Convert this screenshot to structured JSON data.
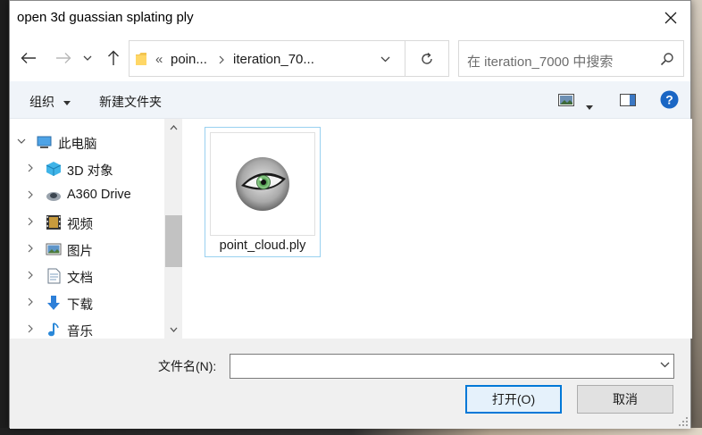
{
  "dialog": {
    "title": "open 3d guassian splating ply"
  },
  "address": {
    "overflow_marker": "«",
    "crumbs": [
      "poin...",
      "iteration_70..."
    ]
  },
  "search": {
    "placeholder": "在 iteration_7000 中搜索"
  },
  "toolbar": {
    "organize_label": "组织",
    "new_folder_label": "新建文件夹"
  },
  "nav": {
    "items": [
      {
        "label": "此电脑",
        "icon": "computer-icon"
      },
      {
        "label": "3D 对象",
        "icon": "3d-objects-icon"
      },
      {
        "label": "A360 Drive",
        "icon": "a360-drive-icon"
      },
      {
        "label": "视频",
        "icon": "videos-icon"
      },
      {
        "label": "图片",
        "icon": "pictures-icon"
      },
      {
        "label": "文档",
        "icon": "documents-icon"
      },
      {
        "label": "下载",
        "icon": "downloads-icon"
      },
      {
        "label": "音乐",
        "icon": "music-icon"
      }
    ]
  },
  "files": [
    {
      "name": "point_cloud.ply",
      "icon": "eye-thumbnail-icon"
    }
  ],
  "footer": {
    "filename_label": "文件名(N):",
    "filename_value": "",
    "open_label": "打开(O)",
    "cancel_label": "取消"
  },
  "colors": {
    "accent": "#0078d7",
    "selection_border": "#99d1f0",
    "toolbar_bg": "#f0f4f9"
  }
}
